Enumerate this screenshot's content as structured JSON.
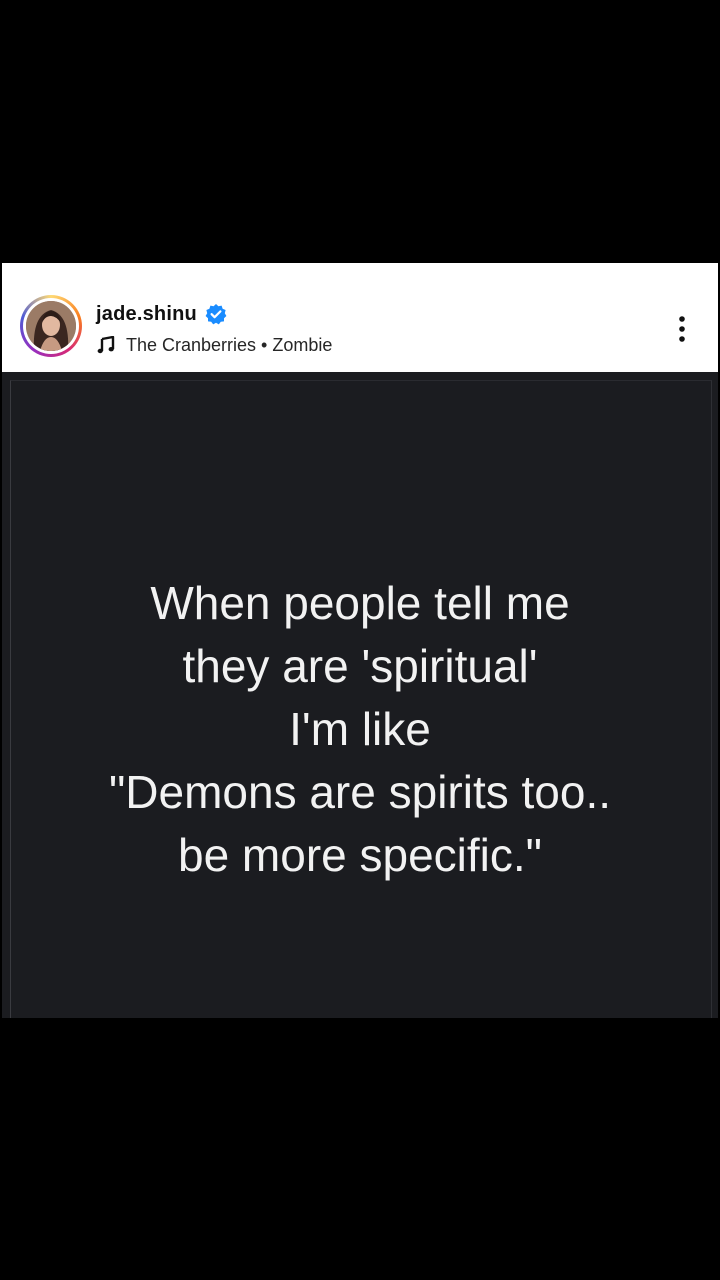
{
  "post": {
    "username": "jade.shinu",
    "verified": true,
    "music": {
      "text": "The Cranberries • Zombie"
    },
    "quote_lines": [
      "When people tell me",
      "they are 'spiritual'",
      "I'm like",
      "\"Demons are spirits too..",
      "be more specific.\""
    ]
  },
  "colors": {
    "background": "#000000",
    "header_bg": "#ffffff",
    "image_bg": "#1b1c20",
    "quote_text": "#f2f2f2",
    "verified_badge": "#1a8cff"
  },
  "icons": {
    "verified": "verified-badge-icon",
    "music": "music-note-icon",
    "menu": "more-vertical-icon"
  }
}
